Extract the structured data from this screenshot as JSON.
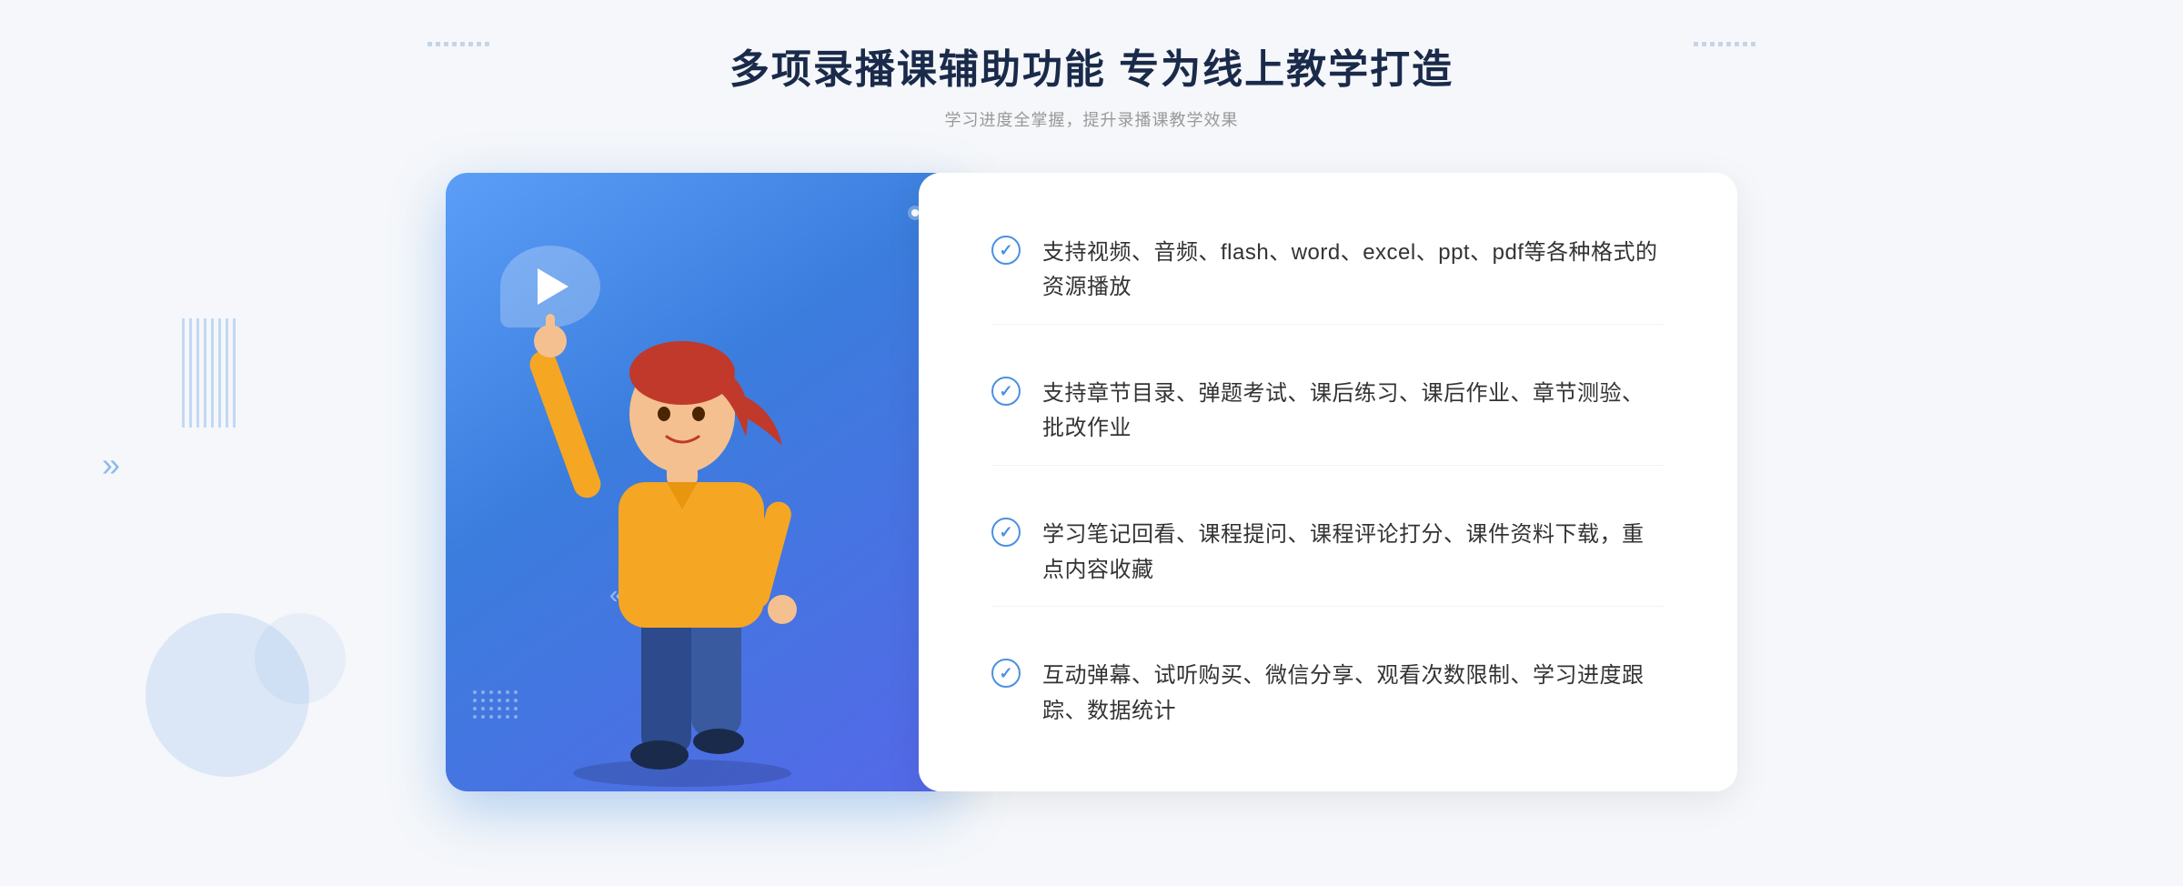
{
  "page": {
    "background_color": "#f5f7fa"
  },
  "header": {
    "main_title": "多项录播课辅助功能 专为线上教学打造",
    "sub_title": "学习进度全掌握，提升录播课教学效果"
  },
  "features": [
    {
      "id": "feature-1",
      "text": "支持视频、音频、flash、word、excel、ppt、pdf等各种格式的资源播放",
      "icon": "check-circle-icon"
    },
    {
      "id": "feature-2",
      "text": "支持章节目录、弹题考试、课后练习、课后作业、章节测验、批改作业",
      "icon": "check-circle-icon"
    },
    {
      "id": "feature-3",
      "text": "学习笔记回看、课程提问、课程评论打分、课件资料下载，重点内容收藏",
      "icon": "check-circle-icon"
    },
    {
      "id": "feature-4",
      "text": "互动弹幕、试听购买、微信分享、观看次数限制、学习进度跟踪、数据统计",
      "icon": "check-circle-icon"
    }
  ],
  "illustration": {
    "play_icon": "▶",
    "decorative_arrow_left": "»",
    "decorative_arrow_card": "«"
  }
}
